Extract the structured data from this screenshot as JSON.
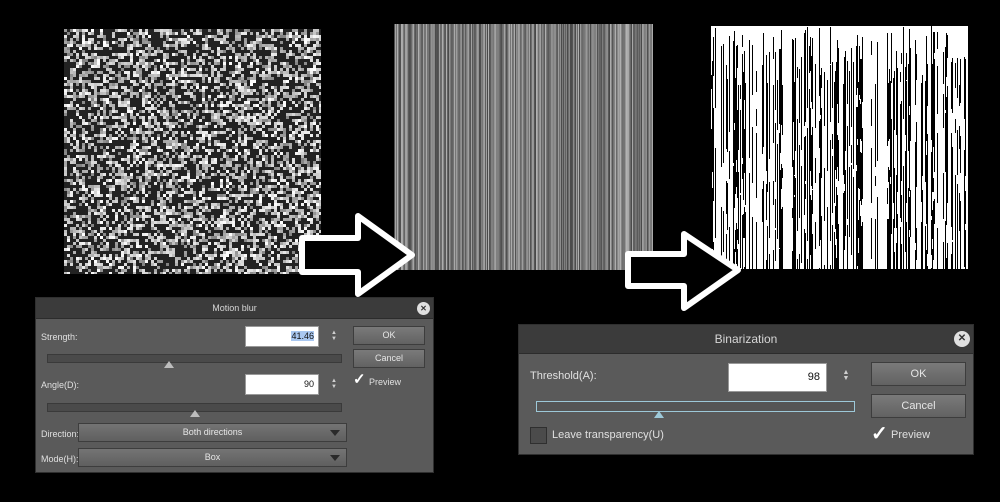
{
  "motion_blur": {
    "title": "Motion blur",
    "close_glyph": "✕",
    "strength_label": "Strength:",
    "strength_value": "41.46",
    "strength_level": 0.4146,
    "angle_label": "Angle(D):",
    "angle_value": "90",
    "angle_level": 0.5,
    "direction_label": "Direction:",
    "direction_value": "Both directions",
    "mode_label": "Mode(H):",
    "mode_value": "Box",
    "ok_label": "OK",
    "cancel_label": "Cancel",
    "preview_label": "Preview",
    "preview_checked": true,
    "spin_glyph": "▲▼"
  },
  "binarization": {
    "title": "Binarization",
    "close_glyph": "✕",
    "threshold_label": "Threshold(A):",
    "threshold_value": "98",
    "threshold_level": 0.3843,
    "leave_transparency_label": "Leave transparency(U)",
    "leave_transparency_checked": false,
    "ok_label": "OK",
    "cancel_label": "Cancel",
    "preview_label": "Preview",
    "preview_checked": true,
    "spin_glyph": "▲▼"
  },
  "colors": {
    "background": "#000000",
    "dialog": "#5a5a5a",
    "title_bar": "#3b3b3b",
    "selection": "#a9c7f0"
  }
}
